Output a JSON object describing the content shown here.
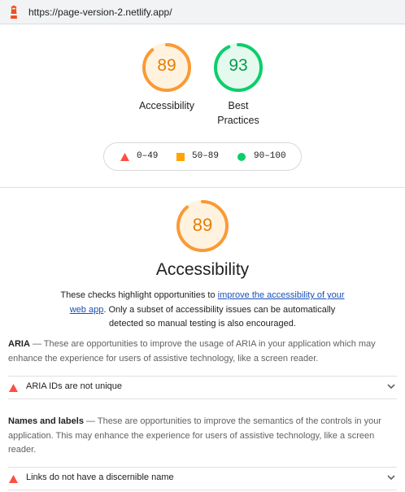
{
  "browser": {
    "url": "https://page-version-2.netlify.app/"
  },
  "summary_gauges": [
    {
      "score": "89",
      "label": "Accessibility",
      "color": "#fa9a36"
    },
    {
      "score": "93",
      "label_line1": "Best",
      "label_line2": "Practices",
      "color": "#0cce6b"
    }
  ],
  "legend": {
    "fail": "0–49",
    "average": "50–89",
    "pass": "90–100",
    "colors": {
      "fail": "#ff4e42",
      "average": "#ffa400",
      "pass": "#0cce6b"
    }
  },
  "category": {
    "score": "89",
    "title": "Accessibility",
    "description_before": "These checks highlight opportunities to ",
    "description_link": "improve the accessibility of your web app",
    "description_after": ". Only a subset of accessibility issues can be automatically detected so manual testing is also encouraged."
  },
  "groups": [
    {
      "title": "ARIA",
      "description": " — These are opportunities to improve the usage of ARIA in your application which may enhance the experience for users of assistive technology, like a screen reader.",
      "audits": [
        {
          "title": "ARIA IDs are not unique"
        }
      ]
    },
    {
      "title": "Names and labels",
      "description": " — These are opportunities to improve the semantics of the controls in your application. This may enhance the experience for users of assistive technology, like a screen reader.",
      "audits": [
        {
          "title": "Links do not have a discernible name"
        }
      ]
    }
  ]
}
